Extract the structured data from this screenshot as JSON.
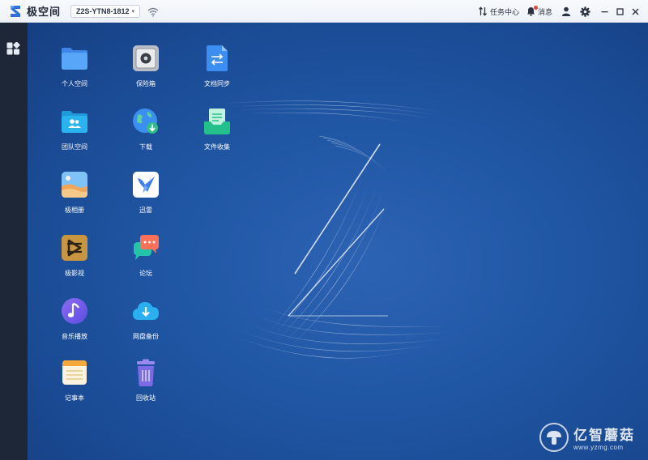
{
  "titlebar": {
    "app_name": "极空间",
    "device": "Z2S-YTN8-1812",
    "tasks_label": "任务中心",
    "messages_label": "消息"
  },
  "apps": [
    {
      "id": "personal",
      "label": "个人空间",
      "icon": "folder-icon"
    },
    {
      "id": "safe",
      "label": "保险箱",
      "icon": "safe-icon"
    },
    {
      "id": "sync",
      "label": "文档同步",
      "icon": "document-sync-icon"
    },
    {
      "id": "team",
      "label": "团队空间",
      "icon": "team-folder-icon"
    },
    {
      "id": "download",
      "label": "下载",
      "icon": "download-globe-icon"
    },
    {
      "id": "collect",
      "label": "文件收集",
      "icon": "file-collection-icon"
    },
    {
      "id": "album",
      "label": "极相册",
      "icon": "photo-album-icon"
    },
    {
      "id": "xunlei",
      "label": "迅雷",
      "icon": "xunlei-bird-icon"
    },
    {
      "id": "video",
      "label": "极影视",
      "icon": "video-icon"
    },
    {
      "id": "forum",
      "label": "论坛",
      "icon": "forum-chat-icon"
    },
    {
      "id": "music",
      "label": "音乐播放",
      "icon": "music-note-icon"
    },
    {
      "id": "backup",
      "label": "网盘备份",
      "icon": "cloud-backup-icon"
    },
    {
      "id": "notes",
      "label": "记事本",
      "icon": "notepad-icon"
    },
    {
      "id": "recycle",
      "label": "回收站",
      "icon": "recycle-bin-icon"
    }
  ],
  "watermark": {
    "name": "亿智蘑菇",
    "url": "www.yzmg.com"
  },
  "colors": {
    "desktop": "#2057a5",
    "sidebar": "#1e2738",
    "titlebar": "#f2f5fa",
    "notification_dot": "#e9443b"
  }
}
